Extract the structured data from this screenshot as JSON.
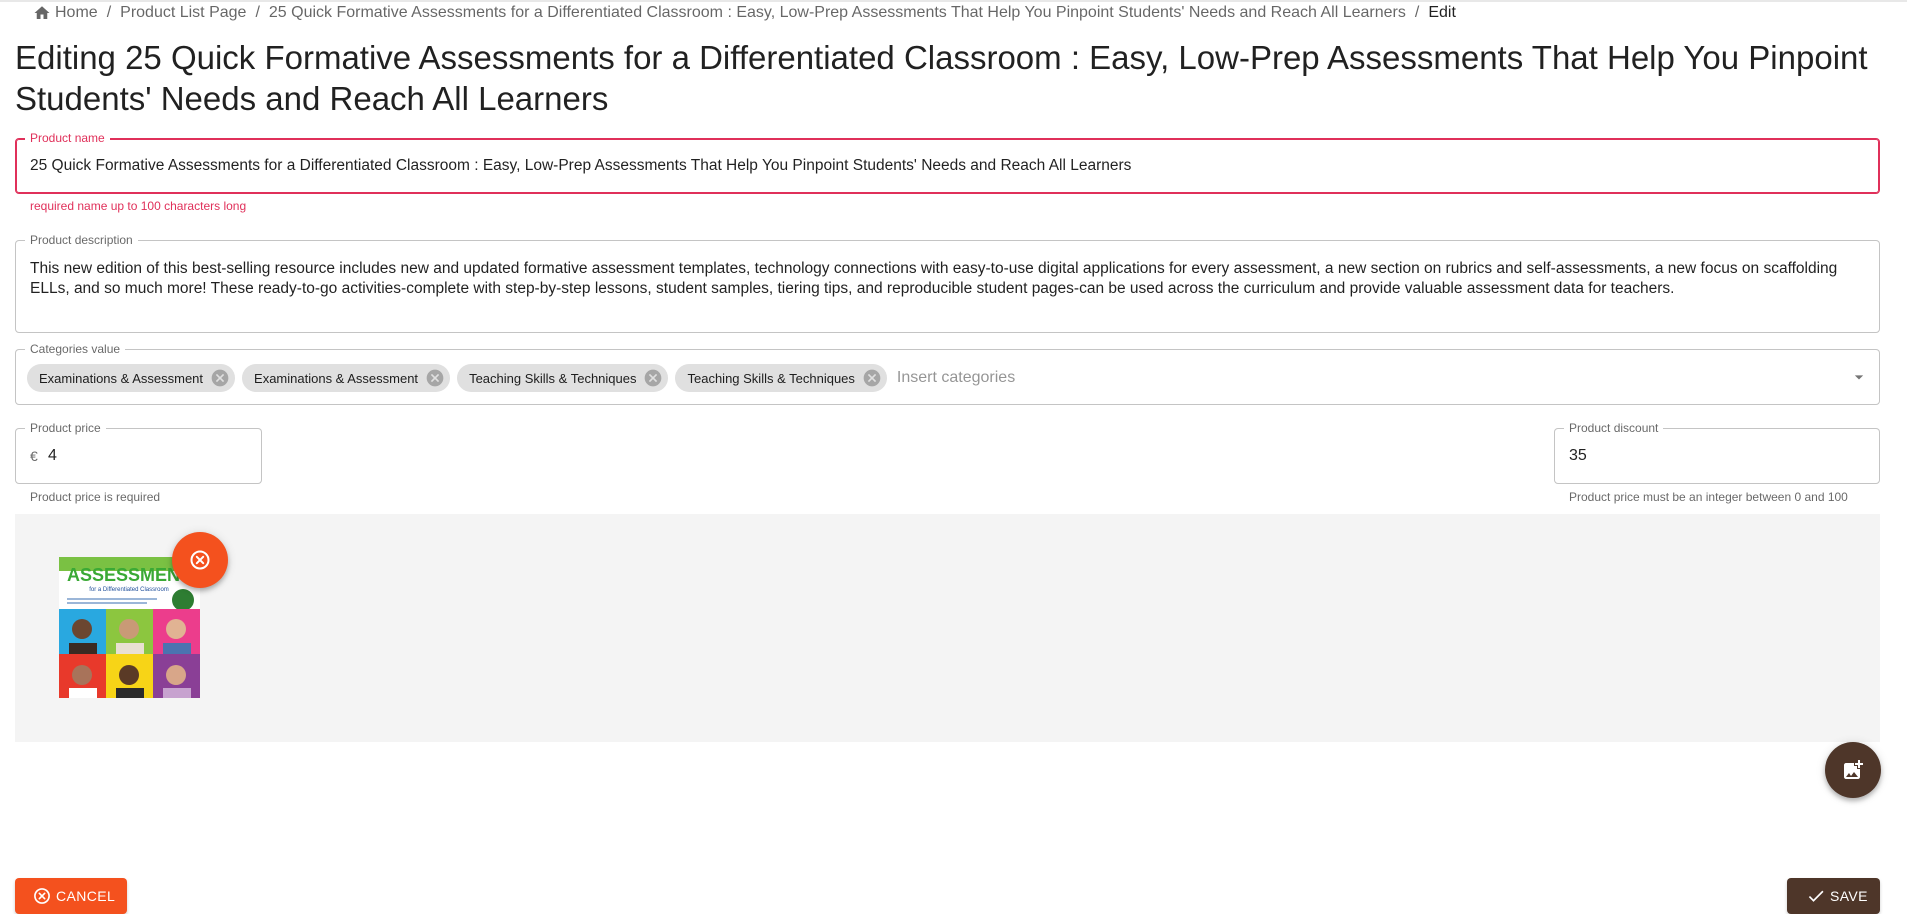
{
  "breadcrumb": {
    "home": "Home",
    "product_list": "Product List Page",
    "product": "25 Quick Formative Assessments for a Differentiated Classroom : Easy, Low-Prep Assessments That Help You Pinpoint Students' Needs and Reach All Learners",
    "current": "Edit",
    "separator": "/"
  },
  "page": {
    "title": "Editing 25 Quick Formative Assessments for a Differentiated Classroom : Easy, Low-Prep Assessments That Help You Pinpoint Students' Needs and Reach All Learners"
  },
  "form": {
    "name": {
      "label": "Product name",
      "value": "25 Quick Formative Assessments for a Differentiated Classroom : Easy, Low-Prep Assessments That Help You Pinpoint Students' Needs and Reach All Learners",
      "helper": "required name up to 100 characters long"
    },
    "description": {
      "label": "Product description",
      "value": "This new edition of this best-selling resource includes new and updated formative assessment templates, technology connections with easy-to-use digital applications for every assessment, a new section on rubrics and self-assessments, a new focus on scaffolding ELLs, and so much more! These ready-to-go activities-complete with step-by-step lessons, student samples, tiering tips, and reproducible student pages-can be used across the curriculum and provide valuable assessment data for teachers."
    },
    "categories": {
      "label": "Categories value",
      "chips": [
        "Examinations & Assessment",
        "Examinations & Assessment",
        "Teaching Skills & Techniques",
        "Teaching Skills & Techniques"
      ],
      "placeholder": "Insert categories"
    },
    "price": {
      "label": "Product price",
      "currency": "€",
      "value": "4",
      "helper": "Product price is required"
    },
    "discount": {
      "label": "Product discount",
      "value": "35",
      "helper": "Product price must be an integer between 0 and 100"
    }
  },
  "image": {
    "cover_title": "ASSESSMENT",
    "cover_subtitle": "for a Differentiated Classroom"
  },
  "actions": {
    "cancel": "CANCEL",
    "save": "SAVE"
  },
  "colors": {
    "error": "#e0305a",
    "primary_orange": "#f4511e",
    "primary_brown": "#4e3629",
    "image_area_bg": "#f4f4f4"
  },
  "icons": [
    "home-icon",
    "cancel-circle-icon",
    "dropdown-arrow-icon",
    "add-photo-icon",
    "check-icon"
  ]
}
